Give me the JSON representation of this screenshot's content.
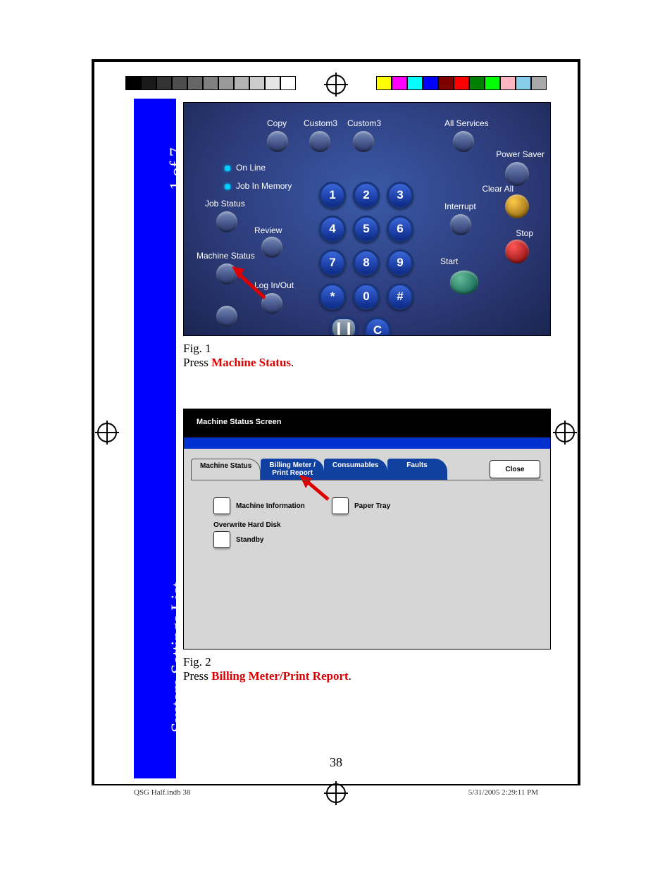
{
  "sidebar": {
    "top": "1 of 7",
    "bottom": "System Settings List"
  },
  "fig1": {
    "topRow": {
      "copy": "Copy",
      "c3a": "Custom3",
      "c3b": "Custom3",
      "all": "All Services"
    },
    "right": {
      "power": "Power Saver",
      "clear": "Clear All",
      "interrupt": "Interrupt",
      "stop": "Stop",
      "start": "Start"
    },
    "left": {
      "online": "On Line",
      "jobmem": "Job In Memory",
      "jobstatus": "Job Status",
      "review": "Review",
      "mstatus": "Machine Status",
      "login": "Log In/Out"
    },
    "keys": {
      "k1": "1",
      "k2": "2",
      "k3": "3",
      "k4": "4",
      "k5": "5",
      "k6": "6",
      "k7": "7",
      "k8": "8",
      "k9": "9",
      "ks": "*",
      "k0": "0",
      "kh": "#",
      "kc": "C"
    },
    "cap_a": "Fig. 1",
    "cap_b": "Press ",
    "cap_hl": "Machine Status",
    "cap_c": "."
  },
  "fig2": {
    "title": "Machine Status Screen",
    "tabs": {
      "t1": "Machine Status",
      "t2a": "Billing Meter /",
      "t2b": "Print Report",
      "t3": "Consumables",
      "t4": "Faults"
    },
    "close": "Close",
    "opt1": "Machine Information",
    "opt2": "Paper Tray",
    "sub1": "Overwrite Hard Disk",
    "sub2": "Standby",
    "cap_a": "Fig. 2",
    "cap_b": "Press ",
    "cap_hl": "Billing Meter/Print Report",
    "cap_c": "."
  },
  "page_number": "38",
  "footer": {
    "left": "QSG Half.indb   38",
    "right": "5/31/2005   2:29:11 PM"
  },
  "gray_strip": [
    "#000",
    "#1a1a1a",
    "#333",
    "#4d4d4d",
    "#666",
    "#808080",
    "#999",
    "#b3b3b3",
    "#ccc",
    "#e6e6e6",
    "#fff"
  ],
  "color_strip": [
    "#ff0",
    "#f0f",
    "#0ff",
    "#00f",
    "#800000",
    "#f00",
    "#008000",
    "#0f0",
    "#ffb6c1",
    "#87ceeb",
    "#a9a9a9"
  ]
}
